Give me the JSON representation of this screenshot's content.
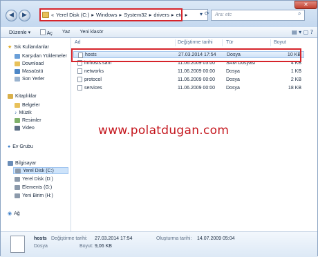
{
  "address": {
    "crumbs": [
      "Yerel Disk (C:)",
      "Windows",
      "System32",
      "drivers",
      "etc"
    ],
    "lead": "«"
  },
  "search": {
    "placeholder": "Ara: etc"
  },
  "toolbar": {
    "organize": "Düzenle",
    "open": "Aç",
    "print": "Yaz",
    "new_folder": "Yeni klasör"
  },
  "sidebar": {
    "favorites_header": "Sık Kullanılanlar",
    "favorites": [
      "Karşıdan Yüklemeler",
      "Download",
      "Masaüstü",
      "Son Yerler"
    ],
    "libraries_header": "Kitaplıklar",
    "libraries": [
      "Belgeler",
      "Müzik",
      "Resimler",
      "Video"
    ],
    "homegroup": "Ev Grubu",
    "computer_header": "Bilgisayar",
    "drives": [
      "Yerel Disk (C:)",
      "Yerel Disk (D:)",
      "Elements (G:)",
      "Yeni Birim (H:)"
    ],
    "network": "Ağ"
  },
  "columns": {
    "name": "Ad",
    "date": "Değiştirme tarihi",
    "type": "Tür",
    "size": "Boyut"
  },
  "files": [
    {
      "name": "hosts",
      "date": "27.03.2014 17:54",
      "type": "Dosya",
      "size": "10 KB"
    },
    {
      "name": "lmhosts.sam",
      "date": "11.06.2009 03:00",
      "type": "SAM Dosyası",
      "size": "4 KB"
    },
    {
      "name": "networks",
      "date": "11.06.2009 00:00",
      "type": "Dosya",
      "size": "1 KB"
    },
    {
      "name": "protocol",
      "date": "11.06.2009 00:00",
      "type": "Dosya",
      "size": "2 KB"
    },
    {
      "name": "services",
      "date": "11.06.2009 00:00",
      "type": "Dosya",
      "size": "18 KB"
    }
  ],
  "watermark": "www.polatdugan.com",
  "details": {
    "name": "hosts",
    "modified_label": "Değiştirme tarihi:",
    "modified_value": "27.03.2014 17:54",
    "created_label": "Oluşturma tarihi:",
    "created_value": "14.07.2009 05:04",
    "type": "Dosya",
    "size_label": "Boyut:",
    "size_value": "9,06 KB"
  },
  "colors": {
    "accent": "#d6232a",
    "selection": "#cfe2f8"
  }
}
